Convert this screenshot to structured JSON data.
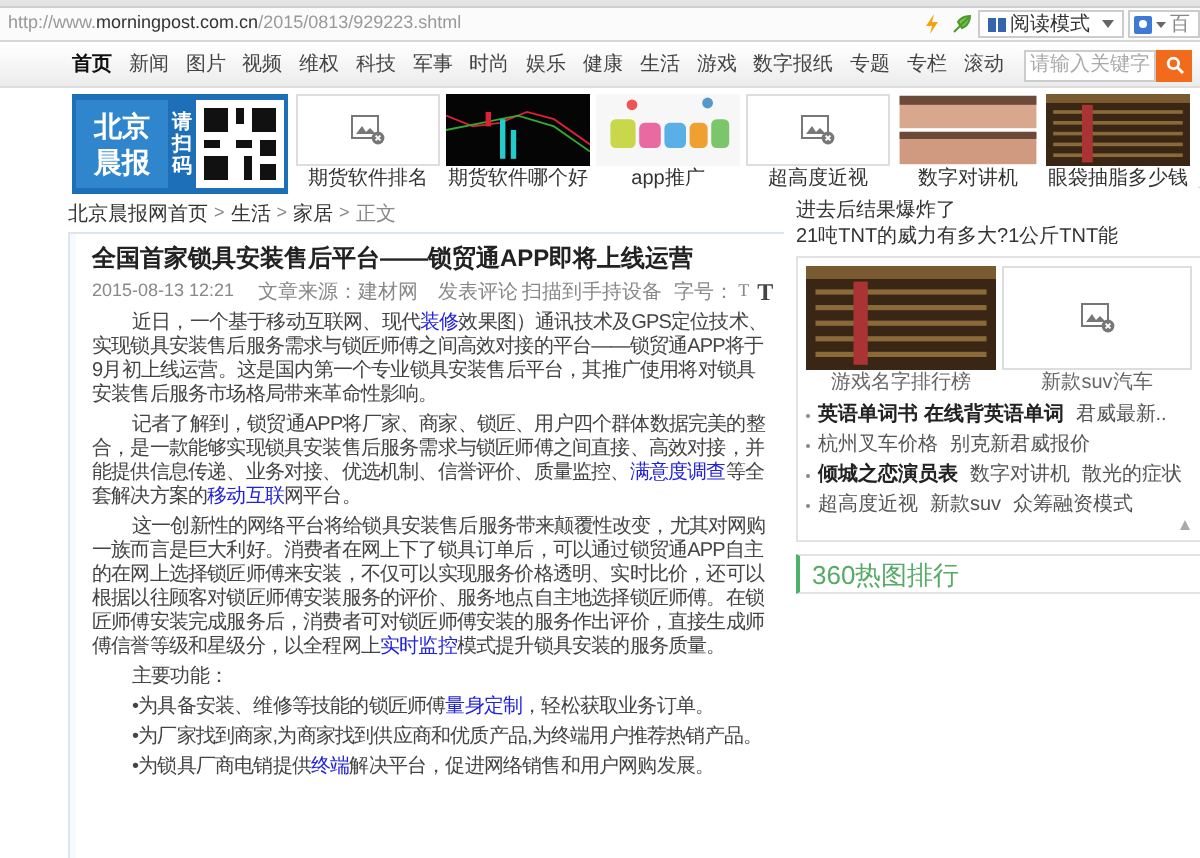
{
  "browser": {
    "url_scheme": "http://www.",
    "url_domain": "morningpost.com.cn",
    "url_path": "/2015/0813/929223.shtml",
    "reader_mode": "阅读模式",
    "search_engine_partial": "百"
  },
  "nav": {
    "items": [
      {
        "label": "首页",
        "selected": true
      },
      {
        "label": "新闻",
        "selected": false
      },
      {
        "label": "图片",
        "selected": false
      },
      {
        "label": "视频",
        "selected": false
      },
      {
        "label": "维权",
        "selected": false
      },
      {
        "label": "科技",
        "selected": false
      },
      {
        "label": "军事",
        "selected": false
      },
      {
        "label": "时尚",
        "selected": false
      },
      {
        "label": "娱乐",
        "selected": false
      },
      {
        "label": "健康",
        "selected": false
      },
      {
        "label": "生活",
        "selected": false
      },
      {
        "label": "游戏",
        "selected": false
      },
      {
        "label": "数字报纸",
        "selected": false
      },
      {
        "label": "专题",
        "selected": false
      },
      {
        "label": "专栏",
        "selected": false
      },
      {
        "label": "滚动",
        "selected": false
      }
    ],
    "search": {
      "placeholder": "请输入关键字"
    }
  },
  "banner": {
    "logo": "北京晨报",
    "scan_text": "请扫码",
    "tiles": [
      {
        "kind": "placeholder",
        "caption": "期货软件排名"
      },
      {
        "kind": "picture",
        "caption": "期货软件哪个好"
      },
      {
        "kind": "picture",
        "caption": "app推广"
      },
      {
        "kind": "placeholder",
        "caption": "超高度近视"
      },
      {
        "kind": "picture",
        "caption": "数字对讲机"
      },
      {
        "kind": "picture",
        "caption": "眼袋抽脂多少钱"
      }
    ]
  },
  "breadcrumb": {
    "separator": ">",
    "items": [
      "北京晨报网首页",
      "生活",
      "家居",
      "正文"
    ]
  },
  "article": {
    "title": "全国首家锁具安装售后平台——锁贸通APP即将上线运营",
    "date": "2015-08-13 12:21",
    "source": "文章来源：建材网",
    "comment": "发表评论",
    "scan": "扫描到手持设备",
    "font_size_label": "字号：",
    "font_sizes": [
      "T",
      "T"
    ],
    "paragraphs": [
      [
        {
          "text": "近日，一个基于移动互联网、现代",
          "link": false
        },
        {
          "text": "装修",
          "link": true
        },
        {
          "text": "效果图）通讯技术及GPS定位技术、实现锁具安装售后服务需求与锁匠师傅之间高效对接的平台——锁贸通APP将于9月初上线运营。这是国内第一个专业锁具安装售后平台，其推广使用将对锁具安装售后服务市场格局带来革命性影响。",
          "link": false
        }
      ],
      [
        {
          "text": "记者了解到，锁贸通APP将厂家、商家、锁匠、用户四个群体数据完美的整合，是一款能够实现锁具安装售后服务需求与锁匠师傅之间直接、高效对接，并能提供信息传递、业务对接、优选机制、信誉评价、质量监控、",
          "link": false
        },
        {
          "text": "满意度调查",
          "link": true
        },
        {
          "text": "等全套解决方案的",
          "link": false
        },
        {
          "text": "移动互联",
          "link": true
        },
        {
          "text": "网平台。",
          "link": false
        }
      ],
      [
        {
          "text": "这一创新性的网络平台将给锁具安装售后服务带来颠覆性改变，尤其对网购一族而言是巨大利好。消费者在网上下了锁具订单后，可以通过锁贸通APP自主的在网上选择锁匠师傅来安装，不仅可以实现服务价格透明、实时比价，还可以根据以往顾客对锁匠师傅安装服务的评价、服务地点自主地选择锁匠师傅。在锁匠师傅安装完成服务后，消费者可对锁匠师傅安装的服务作出评价，直接生成师傅信誉等级和星级分，以全程网上",
          "link": false
        },
        {
          "text": "实时监控",
          "link": true
        },
        {
          "text": "模式提升锁具安装的服务质量。",
          "link": false
        }
      ],
      [
        {
          "text": "主要功能：",
          "link": false
        }
      ],
      [
        {
          "text": "•为具备安装、维修等技能的锁匠师傅",
          "link": false
        },
        {
          "text": "量身定制",
          "link": true
        },
        {
          "text": "，轻松获取业务订单。",
          "link": false
        }
      ],
      [
        {
          "text": "•为厂家找到商家,为商家找到供应商和优质产品,为终端用户推荐热销产品。",
          "link": false
        }
      ],
      [
        {
          "text": "•为锁具厂商电销提供",
          "link": false
        },
        {
          "text": "终端",
          "link": true
        },
        {
          "text": "解决平台，促进网络销售和用户网购发展。",
          "link": false
        }
      ]
    ]
  },
  "sidebar": {
    "headlines": [
      "进去后结果爆炸了",
      "21吨TNT的威力有多大?1公斤TNT能"
    ],
    "promo": {
      "tiles": [
        {
          "kind": "picture",
          "caption": "游戏名字排行榜"
        },
        {
          "kind": "placeholder",
          "caption": "新款suv汽车"
        }
      ],
      "rows": [
        {
          "links": [
            {
              "text": "英语单词书 在线背英语单词",
              "emphasis": true
            },
            {
              "text": "君威最新..",
              "emphasis": false
            }
          ]
        },
        {
          "links": [
            {
              "text": "杭州叉车价格",
              "emphasis": false
            },
            {
              "text": "别克新君威报价",
              "emphasis": false
            }
          ]
        },
        {
          "links": [
            {
              "text": "倾城之恋演员表",
              "emphasis": true
            },
            {
              "text": "数字对讲机",
              "emphasis": false
            },
            {
              "text": "散光的症状",
              "emphasis": false
            }
          ]
        },
        {
          "links": [
            {
              "text": "超高度近视",
              "emphasis": false
            },
            {
              "text": "新款suv",
              "emphasis": false
            },
            {
              "text": "众筹融资模式",
              "emphasis": false
            }
          ]
        }
      ]
    },
    "ranking_title": "360热图排行"
  }
}
